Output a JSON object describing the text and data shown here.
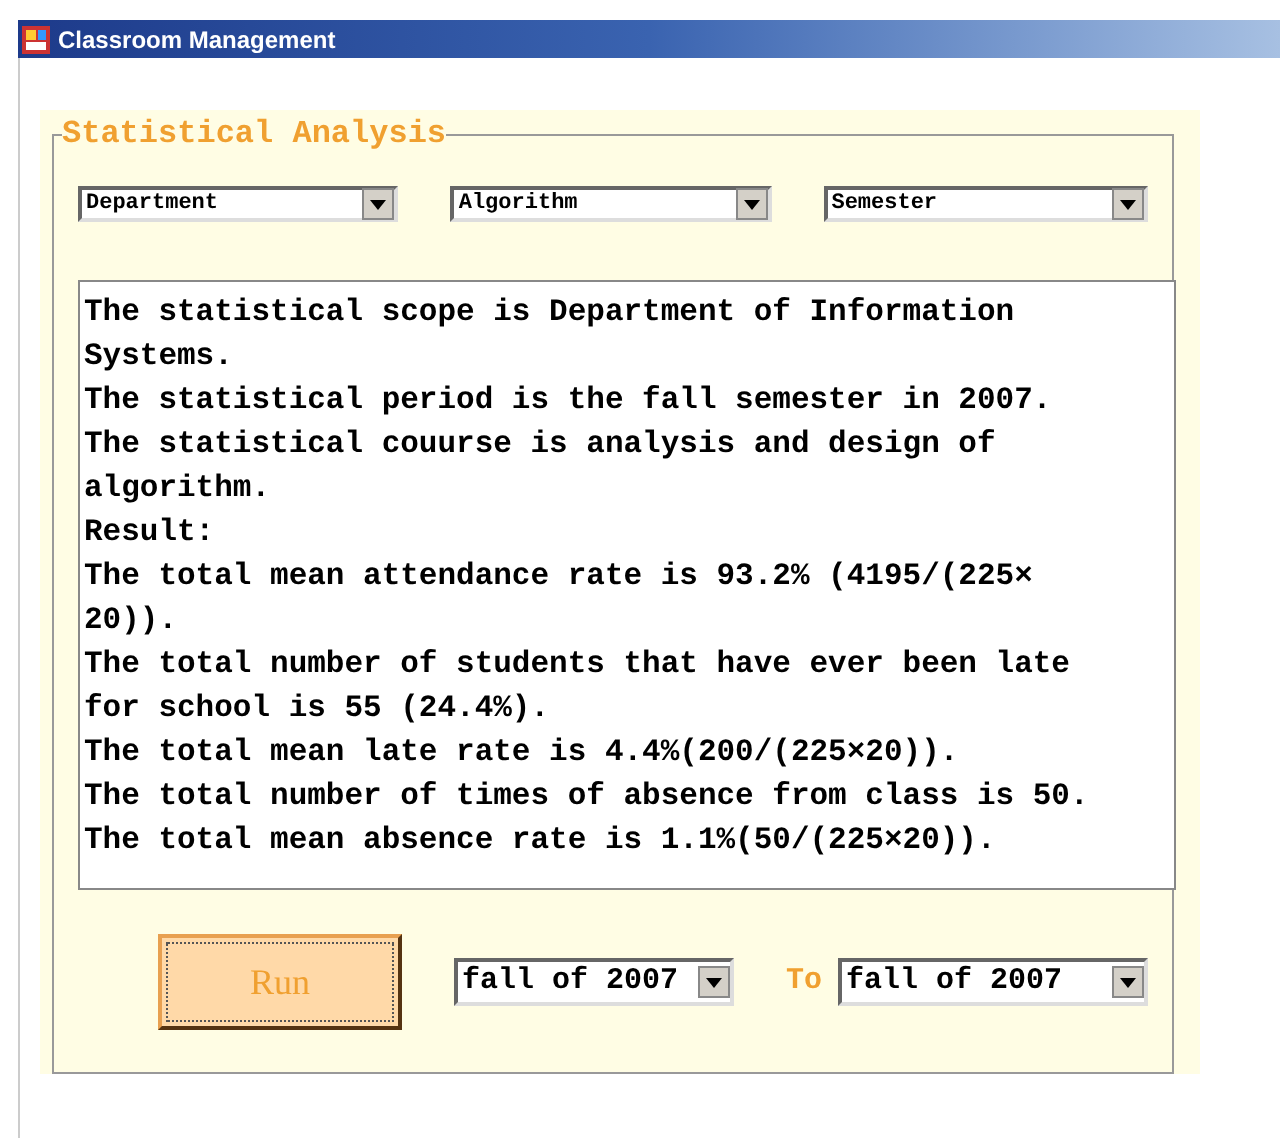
{
  "window": {
    "title": "Classroom Management"
  },
  "group": {
    "title": "Statistical Analysis"
  },
  "filters": [
    {
      "value": "Department"
    },
    {
      "value": "Algorithm"
    },
    {
      "value": "Semester"
    }
  ],
  "result_lines": [
    "The statistical scope is Department of Information",
    "Systems.",
    "The statistical period is the fall semester in 2007.",
    "The statistical couurse is analysis and design of",
    "algorithm.",
    "Result:",
    "The total mean attendance rate is 93.2% (4195/(225×",
    "20)).",
    "The total number of students that have ever been late",
    "for school is 55 (24.4%).",
    "The total mean late rate is 4.4%(200/(225×20)).",
    "The total number of times of absence from class is 50.",
    "The total mean absence rate is 1.1%(50/(225×20))."
  ],
  "run_button": {
    "label": "Run"
  },
  "from": {
    "value": "fall of 2007"
  },
  "to_label": "To",
  "to": {
    "value": "fall of 2007"
  }
}
